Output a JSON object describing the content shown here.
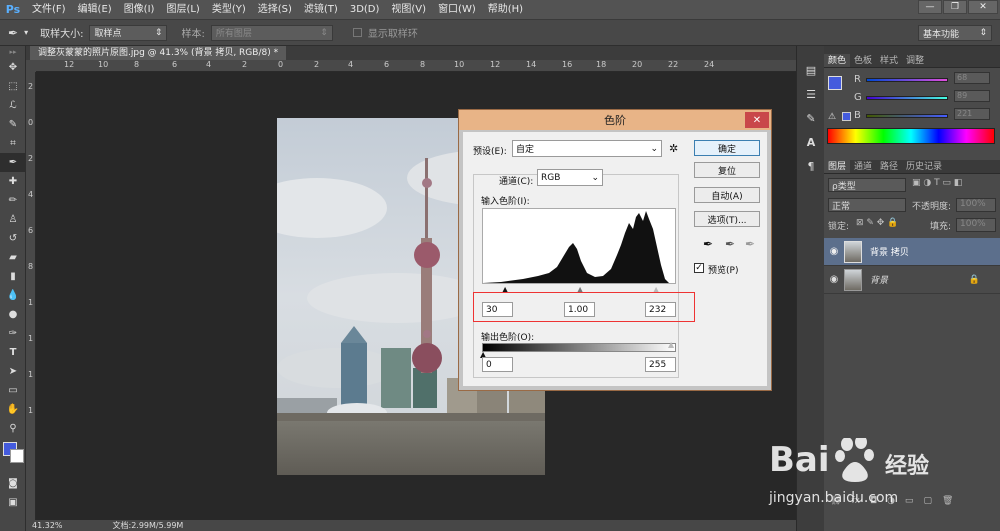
{
  "app": {
    "logo": "Ps"
  },
  "menu": [
    "文件(F)",
    "编辑(E)",
    "图像(I)",
    "图层(L)",
    "类型(Y)",
    "选择(S)",
    "滤镜(T)",
    "3D(D)",
    "视图(V)",
    "窗口(W)",
    "帮助(H)"
  ],
  "window_buttons": {
    "minimize": "—",
    "restore": "❐",
    "close": "✕"
  },
  "options": {
    "sample_size_label": "取样大小:",
    "sample_size_value": "取样点",
    "sample_label": "样本:",
    "sample_value": "所有图层",
    "show_ring_label": "显示取样环",
    "workspace": "基本功能"
  },
  "document_tab": "调整灰蒙蒙的照片原图.jpg @ 41.3% (背景 拷贝, RGB/8) *",
  "ruler_top": [
    "12",
    "10",
    "8",
    "6",
    "4",
    "2",
    "0",
    "2",
    "4",
    "6",
    "8",
    "10",
    "12",
    "14",
    "16",
    "18",
    "20",
    "22",
    "24"
  ],
  "ruler_left": [
    "2",
    "0",
    "2",
    "4",
    "6",
    "8",
    "1",
    "1",
    "1",
    "1"
  ],
  "status": {
    "zoom": "41.32%",
    "doc": "文档:2.99M/5.99M"
  },
  "levels_dialog": {
    "title": "色阶",
    "close": "✕",
    "preset_label": "预设(E):",
    "preset_value": "自定",
    "channel_label": "通道(C):",
    "channel_value": "RGB",
    "input_levels_label": "输入色阶(I):",
    "input_black": "30",
    "input_gamma": "1.00",
    "input_white": "232",
    "output_levels_label": "输出色阶(O):",
    "output_black": "0",
    "output_white": "255",
    "ok": "确定",
    "reset": "复位",
    "auto": "自动(A)",
    "options": "选项(T)...",
    "preview_label": "预览(P)",
    "preview_checked": true
  },
  "color_panel": {
    "tabs": [
      "颜色",
      "色板",
      "样式",
      "调整"
    ],
    "active_tab": "颜色",
    "channels": [
      {
        "label": "R",
        "value": "68"
      },
      {
        "label": "G",
        "value": "89"
      },
      {
        "label": "B",
        "value": "221"
      }
    ],
    "foreground_color": "#445bdd",
    "accent": "#445bdd"
  },
  "layers_panel": {
    "tabs": [
      "图层",
      "通道",
      "路径",
      "历史记录"
    ],
    "active_tab": "图层",
    "filter": "ρ类型",
    "blend_mode": "正常",
    "opacity_label": "不透明度:",
    "opacity_value": "100%",
    "lock_label": "锁定:",
    "fill_label": "填充:",
    "fill_value": "100%",
    "layers": [
      {
        "name": "背景 拷贝",
        "selected": true,
        "locked": false
      },
      {
        "name": "背景",
        "selected": false,
        "locked": true
      }
    ]
  },
  "watermark": {
    "brand": "Bai",
    "brand2": "经验",
    "url": "jingyan.baidu.com"
  }
}
